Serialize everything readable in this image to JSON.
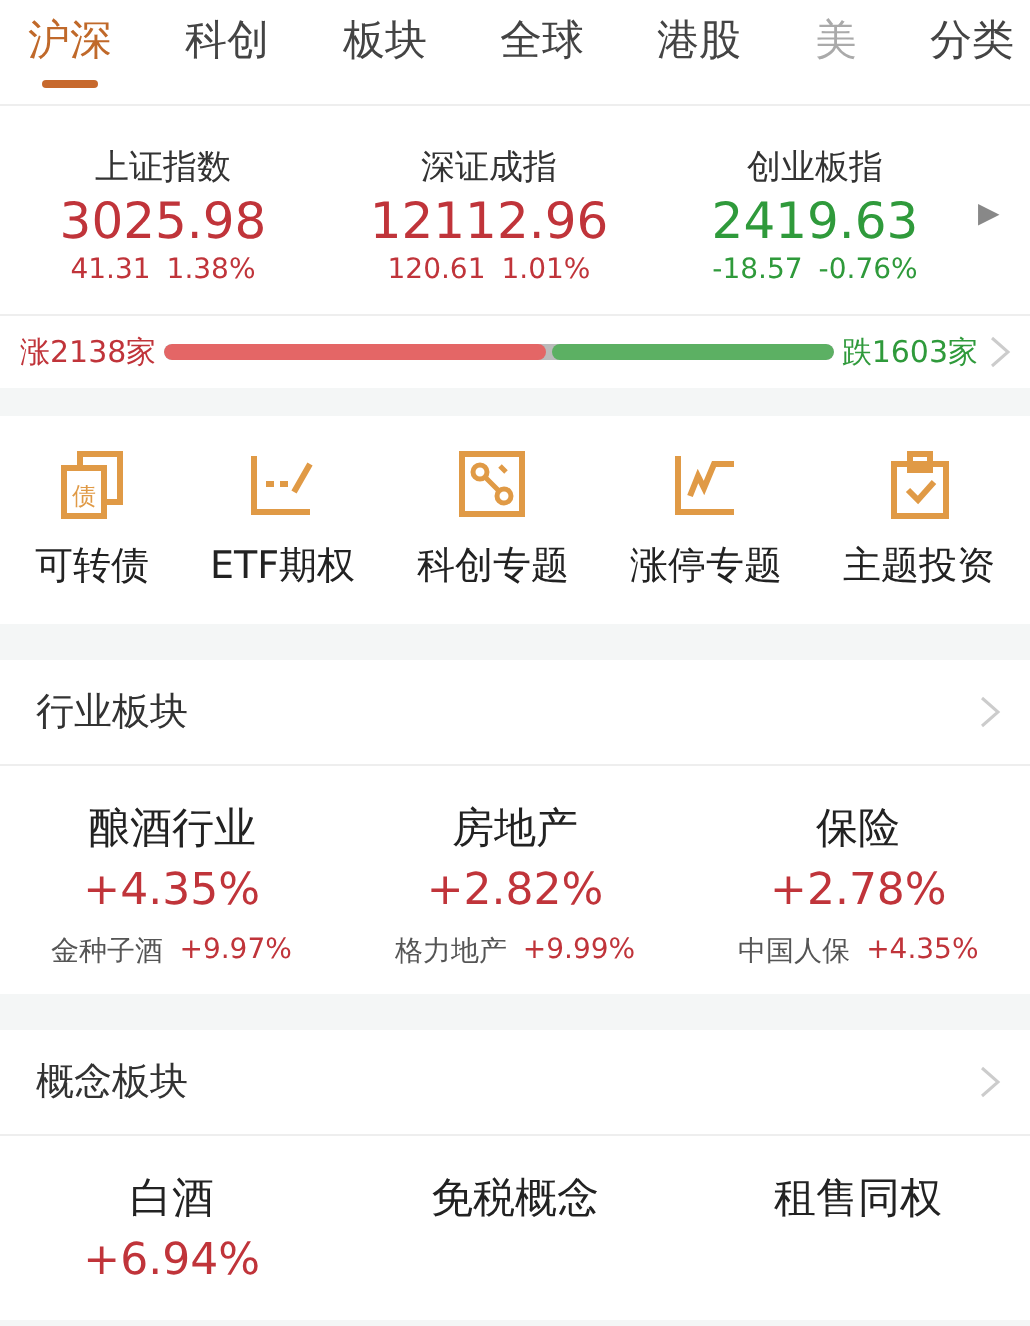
{
  "tabs": [
    {
      "label": "沪深",
      "selected": true
    },
    {
      "label": "科创",
      "selected": false
    },
    {
      "label": "板块",
      "selected": false
    },
    {
      "label": "全球",
      "selected": false
    },
    {
      "label": "港股",
      "selected": false
    },
    {
      "label": "美",
      "selected": false
    },
    {
      "label": "分类",
      "selected": false
    }
  ],
  "indices": [
    {
      "name": "上证指数",
      "value": "3025.98",
      "change": "41.31",
      "percent": "1.38%",
      "color": "#c0343a"
    },
    {
      "name": "深证成指",
      "value": "12112.96",
      "change": "120.61",
      "percent": "1.01%",
      "color": "#c0343a"
    },
    {
      "name": "创业板指",
      "value": "2419.63",
      "change": "-18.57",
      "percent": "-0.76%",
      "color": "#2f9a3b"
    }
  ],
  "more_arrow": "▶",
  "breadth": {
    "up_label": "涨2138家",
    "down_label": "跌1603家",
    "up_bar": {
      "level": 0.57
    },
    "down_bar": {
      "level": 0.42
    }
  },
  "shortcuts": [
    {
      "label": "可转债",
      "icon_text": "债"
    },
    {
      "label": "ETF期权"
    },
    {
      "label": "科创专题"
    },
    {
      "label": "涨停专题"
    },
    {
      "label": "主题投资"
    }
  ],
  "sections": [
    {
      "title": "行业板块",
      "cards": [
        {
          "name": "酿酒行业",
          "percent": "+4.35%",
          "leader": "金种子酒",
          "leader_percent": "+9.97%"
        },
        {
          "name": "房地产",
          "percent": "+2.82%",
          "leader": "格力地产",
          "leader_percent": "+9.99%"
        },
        {
          "name": "保险",
          "percent": "+2.78%",
          "leader": "中国人保",
          "leader_percent": "+4.35%"
        }
      ]
    },
    {
      "title": "概念板块",
      "cards": [
        {
          "name": "白酒",
          "percent": "+6.94%"
        },
        {
          "name": "免税概念"
        },
        {
          "name": "租售同权"
        }
      ]
    }
  ]
}
